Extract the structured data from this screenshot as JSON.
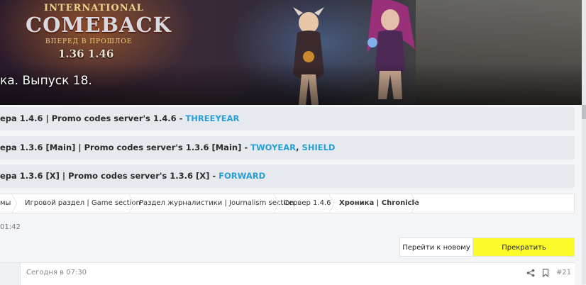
{
  "banner": {
    "logo_top": "INTERNATIONAL",
    "logo_main": "COMEBACK",
    "logo_sub": "ВПЕРЕД В ПРОШЛОЕ",
    "logo_versions": "1.36 1.46",
    "title": "ка. Выпуск 18."
  },
  "promos": [
    {
      "text": "ера 1.4.6 | Promo codes server's 1.4.6 - ",
      "codes": [
        "THREEYEAR"
      ]
    },
    {
      "text": "ера 1.3.6 [Main] | Promo codes server's 1.3.6 [Main] - ",
      "codes": [
        "TWOYEAR",
        "SHIELD"
      ]
    },
    {
      "text": "ера 1.3.6 [X] | Promo codes server's 1.3.6 [X] - ",
      "codes": [
        "FORWARD"
      ]
    }
  ],
  "breadcrumb": [
    "мы",
    "Игровой раздел | Game section",
    "Раздел журналистики | Journalism section",
    "Сервер 1.4.6",
    "Хроника | Chronicle"
  ],
  "thread_time": "01:42",
  "buttons": {
    "go_new": "Перейти к новому",
    "stop_watch": "Прекратить отслеживание"
  },
  "post": {
    "date": "Сегодня в 07:30",
    "number": "#21"
  },
  "colors": {
    "promo_code": "#2a9fd6",
    "highlight": "#fbfb2a",
    "promo_bg": "#e6e9ee"
  }
}
